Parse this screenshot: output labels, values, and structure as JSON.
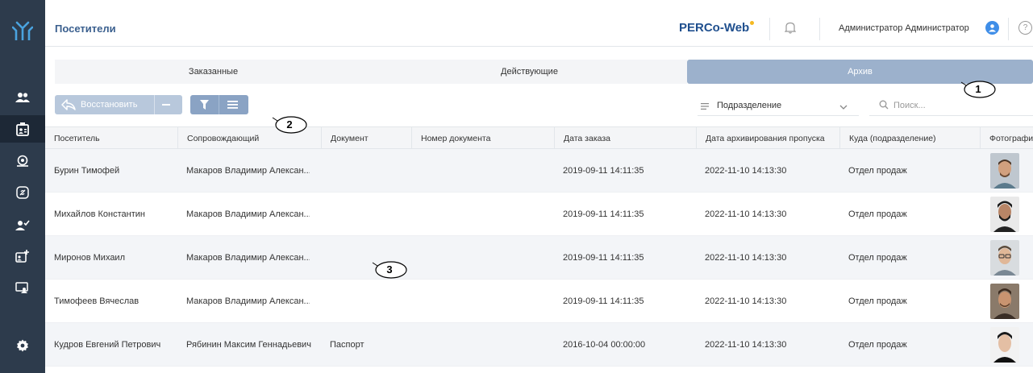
{
  "header": {
    "title": "Посетители",
    "brand": "PERCo-Web",
    "user_name": "Администратор Администратор",
    "help_symbol": "?"
  },
  "tabs": [
    {
      "label": "Заказанные",
      "active": false
    },
    {
      "label": "Действующие",
      "active": false
    },
    {
      "label": "Архив",
      "active": true
    }
  ],
  "toolbar": {
    "restore_label": "Восстановить",
    "department_label": "Подразделение",
    "search_placeholder": "Поиск..."
  },
  "table": {
    "columns": [
      "Посетитель",
      "Сопровождающий",
      "Документ",
      "Номер документа",
      "Дата заказа",
      "Дата архивирования пропуска",
      "Куда (подразделение)",
      "Фотография"
    ],
    "rows": [
      {
        "visitor": "Бурин Тимофей",
        "escort": "Макаров Владимир Александрович",
        "document": "",
        "doc_number": "",
        "order_date": "2019-09-11 14:11:35",
        "archive_date": "2022-11-10 14:13:30",
        "department": "Отдел продаж"
      },
      {
        "visitor": "Михайлов Константин",
        "escort": "Макаров Владимир Александрович",
        "document": "",
        "doc_number": "",
        "order_date": "2019-09-11 14:11:35",
        "archive_date": "2022-11-10 14:13:30",
        "department": "Отдел продаж"
      },
      {
        "visitor": "Миронов Михаил",
        "escort": "Макаров Владимир Александрович",
        "document": "",
        "doc_number": "",
        "order_date": "2019-09-11 14:11:35",
        "archive_date": "2022-11-10 14:13:30",
        "department": "Отдел продаж"
      },
      {
        "visitor": "Тимофеев Вячеслав",
        "escort": "Макаров Владимир Александрович",
        "document": "",
        "doc_number": "",
        "order_date": "2019-09-11 14:11:35",
        "archive_date": "2022-11-10 14:13:30",
        "department": "Отдел продаж"
      },
      {
        "visitor": "Кудров Евгений Петрович",
        "escort": "Рябинин Максим Геннадьевич",
        "document": "Паспорт",
        "doc_number": "",
        "order_date": "2016-10-04 00:00:00",
        "archive_date": "2022-11-10 14:13:30",
        "department": "Отдел продаж"
      }
    ]
  },
  "callouts": [
    "1",
    "2",
    "3"
  ],
  "colors": {
    "sidebar": "#2d3b4c",
    "accent": "#3a5f8e",
    "active_tab": "#9cb1cc",
    "brand_dot": "#f5b921"
  },
  "icons": [
    "perco-logo-icon",
    "visitors-icon",
    "visitor-card-icon",
    "location-icon",
    "pass-icon",
    "user-check-icon",
    "add-card-icon",
    "terminal-icon",
    "settings-icon",
    "bell-icon",
    "user-circle-icon",
    "help-icon",
    "restore-icon",
    "filter-icon",
    "menu-icon",
    "list-icon",
    "chevron-down-icon",
    "search-icon"
  ]
}
